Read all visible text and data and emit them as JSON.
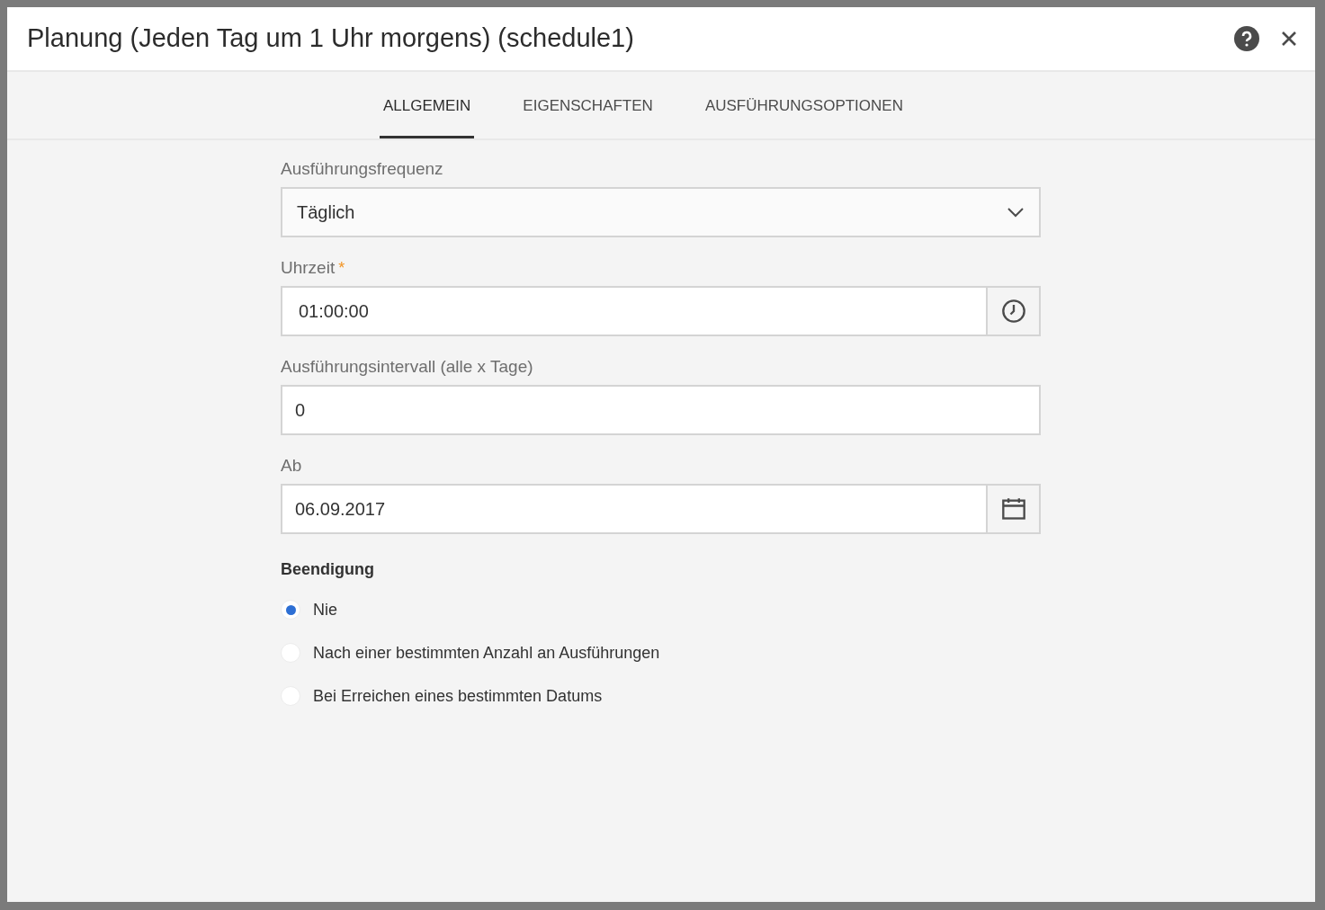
{
  "dialog": {
    "title": "Planung (Jeden Tag um 1 Uhr morgens) (schedule1)"
  },
  "tabs": [
    {
      "label": "ALLGEMEIN",
      "selected": true
    },
    {
      "label": "EIGENSCHAFTEN",
      "selected": false
    },
    {
      "label": "AUSFÜHRUNGSOPTIONEN",
      "selected": false
    }
  ],
  "fields": [
    {
      "kind": "select",
      "label": "Ausführungsfrequenz",
      "value": "Täglich"
    },
    {
      "kind": "time",
      "label": "Uhrzeit",
      "value": "01:00:00",
      "required_mark": "*"
    },
    {
      "kind": "text",
      "label": "Ausführungsintervall (alle x Tage)",
      "value": "0"
    },
    {
      "kind": "date",
      "label": "Ab",
      "value": "06.09.2017"
    }
  ],
  "termination": {
    "label": "Beendigung",
    "options": [
      {
        "label": "Nie",
        "selected": true
      },
      {
        "label": "Nach einer bestimmten Anzahl an Ausführungen",
        "selected": false
      },
      {
        "label": "Bei Erreichen eines bestimmten Datums",
        "selected": false
      }
    ]
  }
}
